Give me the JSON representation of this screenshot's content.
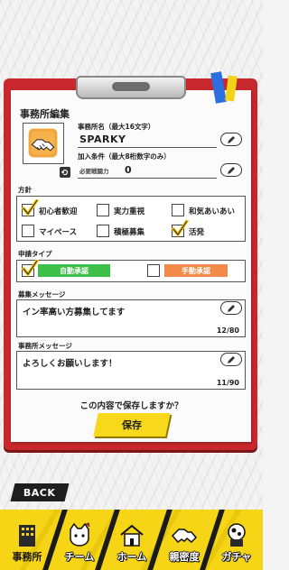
{
  "colors": {
    "clipboard": "#c8282d",
    "accent_yellow": "#f6d416",
    "auto_approve": "#3ebf4a",
    "manual_approve": "#f28b4a",
    "check": "#f2c500"
  },
  "title": "事務所編集",
  "name_section": {
    "label": "事務所名（最大16文字）",
    "value": "SPARKY"
  },
  "join_section": {
    "label": "加入条件（最大8桁数字のみ）",
    "power_label": "必要戦闘力",
    "value": "0"
  },
  "policy": {
    "label": "方針",
    "options": [
      {
        "label": "初心者歓迎",
        "checked": true
      },
      {
        "label": "実力重視",
        "checked": false
      },
      {
        "label": "和気あいあい",
        "checked": false
      },
      {
        "label": "マイペース",
        "checked": false
      },
      {
        "label": "積極募集",
        "checked": false
      },
      {
        "label": "活発",
        "checked": true
      }
    ]
  },
  "approval": {
    "label": "申請タイプ",
    "auto_label": "自動承認",
    "auto_checked": true,
    "manual_label": "手動承認",
    "manual_checked": false
  },
  "recruit_message": {
    "label": "募集メッセージ",
    "value": "イン率高い方募集してます",
    "counter": "12/80"
  },
  "office_message": {
    "label": "事務所メッセージ",
    "value": "よろしくお願いします！",
    "counter": "11/90"
  },
  "confirm_text": "この内容で保存しますか？",
  "save_label": "保存",
  "back_label": "BACK",
  "nav": [
    {
      "label": "事務所",
      "icon": "office-building-icon",
      "active": true
    },
    {
      "label": "チーム",
      "icon": "team-cat-icon",
      "active": false
    },
    {
      "label": "ホーム",
      "icon": "home-icon",
      "active": false
    },
    {
      "label": "親密度",
      "icon": "handshake-icon",
      "active": false
    },
    {
      "label": "ガチャ",
      "icon": "gacha-icon",
      "active": false
    }
  ]
}
